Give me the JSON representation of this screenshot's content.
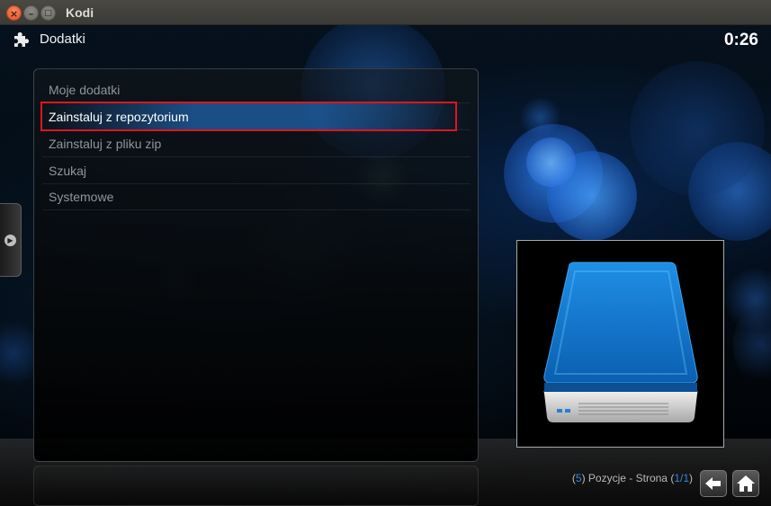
{
  "window": {
    "title": "Kodi",
    "close_glyph": "×",
    "minimize_glyph": "–",
    "maximize_glyph": "□"
  },
  "header": {
    "icon": "puzzle-icon",
    "title": "Dodatki",
    "clock": "0:26"
  },
  "menu": {
    "items": [
      {
        "label": "Moje dodatki",
        "selected": false
      },
      {
        "label": "Zainstaluj z repozytorium",
        "selected": true
      },
      {
        "label": "Zainstaluj z pliku zip",
        "selected": false
      },
      {
        "label": "Szukaj",
        "selected": false
      },
      {
        "label": "Systemowe",
        "selected": false
      }
    ]
  },
  "thumbnail": {
    "icon": "hard-drive-icon"
  },
  "footer": {
    "count_open": "(",
    "count": "5",
    "count_close": ")",
    "label": " Pozycje - Strona ",
    "page_open": "(",
    "page": "1/1",
    "page_close": ")",
    "back_icon": "back-arrow-icon",
    "home_icon": "home-icon"
  },
  "colors": {
    "accent_blue": "#2f8bdc",
    "highlight_red": "#e0141e",
    "selected_text": "#ffffff",
    "menu_text": "#8e969c"
  }
}
